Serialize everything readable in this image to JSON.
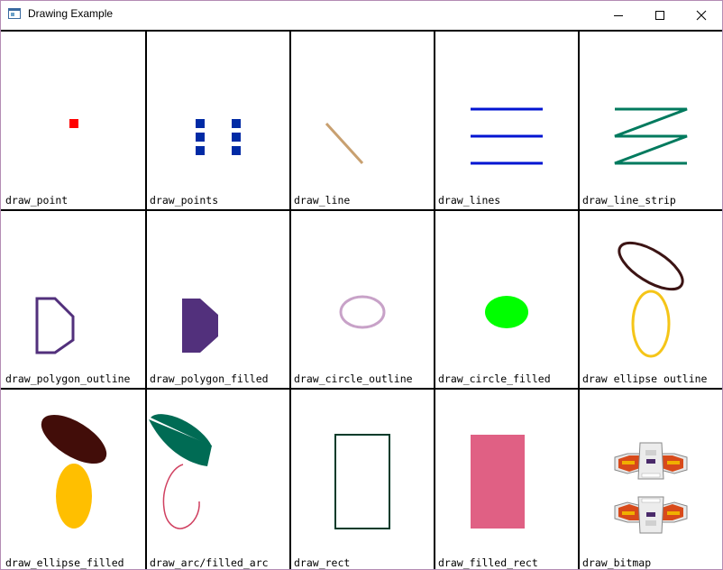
{
  "window": {
    "title": "Drawing Example",
    "border_color": "#b48cb4"
  },
  "titlebar_buttons": [
    {
      "name": "minimize-button",
      "icon": "minimize-icon"
    },
    {
      "name": "maximize-button",
      "icon": "maximize-icon"
    },
    {
      "name": "close-button",
      "icon": "close-icon"
    }
  ],
  "cells": {
    "c0": "draw_point",
    "c1": "draw_points",
    "c2": "draw_line",
    "c3": "draw_lines",
    "c4": "draw_line_strip",
    "c5": "draw_polygon_outline",
    "c6": "draw_polygon_filled",
    "c7": "draw_circle_outline",
    "c8": "draw_circle_filled",
    "c9": "draw_ellipse_outline",
    "c10": "draw_ellipse_filled",
    "c11": "draw_arc/filled_arc",
    "c12": "draw_rect",
    "c13": "draw_filled_rect",
    "c14": "draw_bitmap"
  },
  "colors": {
    "point": "#ff0000",
    "points": "#002aa5",
    "line": "#c8a070",
    "lines": "#0014d2",
    "line_strip": "#007a5e",
    "polygon_outline": "#52307c",
    "polygon_filled": "#52307c",
    "circle_outline": "#c8a2c8",
    "circle_filled": "#00ff00",
    "ellipse_outline_top": "#3c1414",
    "ellipse_outline_bottom": "#f5c518",
    "ellipse_filled_top": "#420d09",
    "ellipse_filled_bottom": "#ffbf00",
    "filled_arc": "#006b54",
    "arc": "#d04060",
    "rect": "#003b2a",
    "filled_rect": "#e06084",
    "grid_line": "#000000"
  }
}
